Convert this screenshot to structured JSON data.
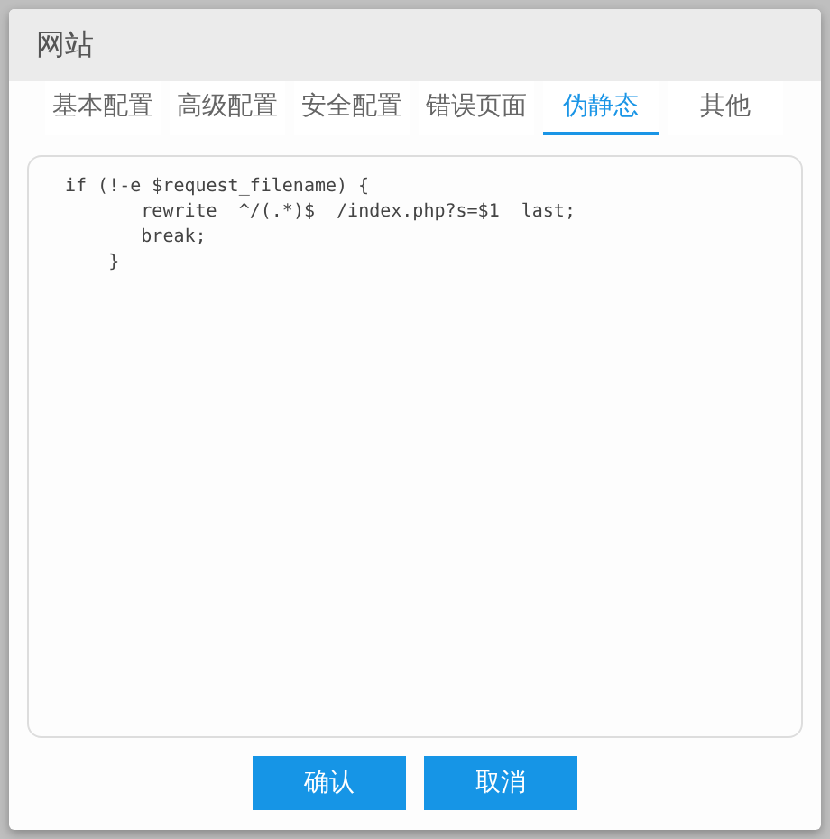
{
  "dialog": {
    "title": "网站",
    "tabs": [
      {
        "label": "基本配置",
        "selected": false
      },
      {
        "label": "高级配置",
        "selected": false
      },
      {
        "label": "安全配置",
        "selected": false
      },
      {
        "label": "错误页面",
        "selected": false
      },
      {
        "label": "伪静态",
        "selected": true
      },
      {
        "label": "其他",
        "selected": false
      }
    ],
    "editor": {
      "value": "if (!-e $request_filename) {\n       rewrite  ^/(.*)$  /index.php?s=$1  last;\n       break;\n    }"
    },
    "buttons": [
      "确认",
      "取消"
    ]
  }
}
